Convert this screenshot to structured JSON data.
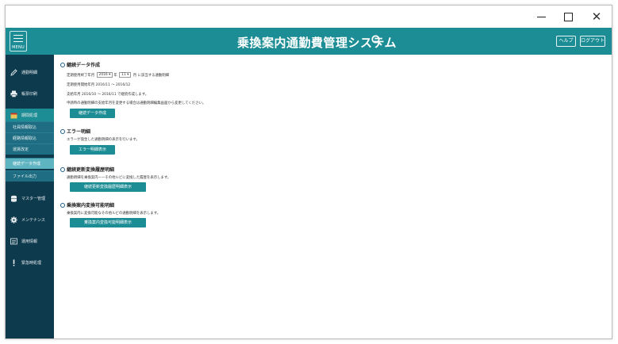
{
  "window": {
    "minimize_glyph": "",
    "maximize_glyph": "",
    "close_glyph": "✕"
  },
  "header": {
    "menu_label": "MENU",
    "title": "乗換案内通勤費管理システム",
    "help_label": "ヘルプ",
    "logout_label": "ログアウト",
    "accent_color": "#1c8d95"
  },
  "sidebar": {
    "items": [
      {
        "label": "通勤明細",
        "icon": "pencil-icon"
      },
      {
        "label": "帳票印刷",
        "icon": "printer-icon"
      },
      {
        "label": "期間処理",
        "icon": "calendar-icon"
      },
      {
        "label": "マスター管理",
        "icon": "database-icon"
      },
      {
        "label": "メンテナンス",
        "icon": "gear-icon"
      },
      {
        "label": "運用情報",
        "icon": "info-icon"
      },
      {
        "label": "緊急時処理",
        "icon": "exclamation-icon"
      }
    ],
    "sub_items": [
      {
        "label": "社員情報取込"
      },
      {
        "label": "経路情報取込"
      },
      {
        "label": "運賃改定"
      },
      {
        "label": "継続データ作成"
      },
      {
        "label": "ファイル出力"
      }
    ]
  },
  "main": {
    "sections": [
      {
        "title": "継続データ作成",
        "lines": [
          "定期使用終了年月",
          "月 に該当する通勤明細",
          "定期使用開始年月 2016/11 ～ 2016/12",
          "支給年月 2016/10 ～ 2016/11 で継続作成します。",
          "申請時の通勤明細の支給年月を変更する場合は通勤明細編集画面から変更してください。"
        ],
        "year_value": "2016",
        "month_value": "11",
        "year_suffix": "年",
        "button": "継続データ作成"
      },
      {
        "title": "エラー明細",
        "lines": [
          "エラーが発生した通勤明細の表示を行います。"
        ],
        "button": "エラー明細表示"
      },
      {
        "title": "継続更新変換履歴明細",
        "lines": [
          "通勤明細を乗換案内ーーその他ルビに変換した履歴を表示します。"
        ],
        "button": "継続更新変換履歴明細表示"
      },
      {
        "title": "乗換案内変換可能明細",
        "lines": [
          "乗換案内に変換可能なその他ルビの通勤明細を表示します。"
        ],
        "button": "乗換案内変換可能明細表示"
      }
    ]
  }
}
